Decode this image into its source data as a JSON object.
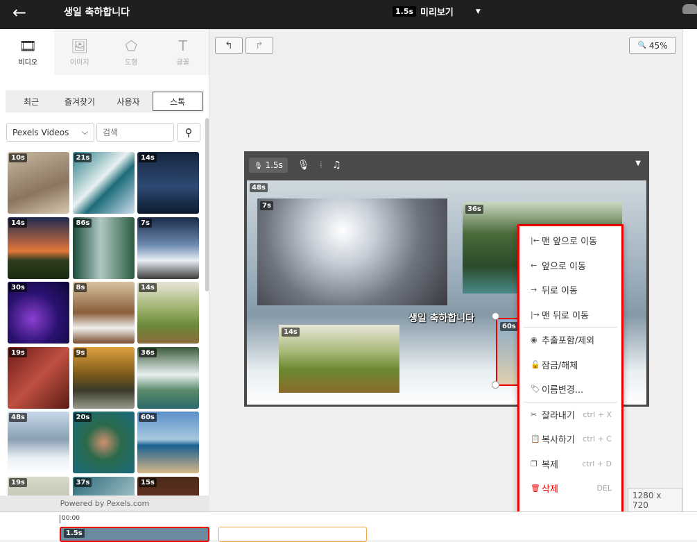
{
  "header": {
    "back_icon": "←",
    "title": "생일 축하합니다",
    "duration_tag": "1.5s",
    "preview_label": "미리보기",
    "caret": "▼"
  },
  "media_tabs": [
    {
      "label": "비디오",
      "icon": "film-icon",
      "glyph": "🎞",
      "active": true
    },
    {
      "label": "이미지",
      "icon": "image-icon",
      "glyph": "🖼",
      "active": false
    },
    {
      "label": "도형",
      "icon": "pentagon-icon",
      "glyph": "⬠",
      "active": false
    },
    {
      "label": "글꼴",
      "icon": "text-icon",
      "glyph": "T",
      "active": false
    }
  ],
  "sub_tabs": [
    {
      "label": "최근",
      "active": false
    },
    {
      "label": "즐겨찾기",
      "active": false
    },
    {
      "label": "사용자",
      "active": false
    },
    {
      "label": "스톡",
      "active": true
    }
  ],
  "search": {
    "source": "Pexels Videos",
    "placeholder": "검색"
  },
  "thumbnails": [
    {
      "dur": "10s",
      "bg": "linear-gradient(160deg,#c8b8a0,#8a7560 60%,#d9c9b0)"
    },
    {
      "dur": "21s",
      "bg": "linear-gradient(135deg,#2a7f8a,#e8f0f0 45%,#1d6c7a 60%,#cde)"
    },
    {
      "dur": "14s",
      "bg": "linear-gradient(180deg,#16243d,#2e4a74 55%,#0c1a2e)"
    },
    {
      "dur": "14s",
      "bg": "linear-gradient(180deg,#1d2a50,#e2763a 55%,#2e3d1e 70%,#1a2a10)"
    },
    {
      "dur": "86s",
      "bg": "linear-gradient(90deg,#1b4c3a,#b0c8c4 45%,#2a5c40)"
    },
    {
      "dur": "7s",
      "bg": "linear-gradient(180deg,#1b2b4a,#6d8bb0 45%,#e8eef4 70%,#3b3b3b)"
    },
    {
      "dur": "30s",
      "bg": "radial-gradient(circle at 40% 60%,#8b3fd0,#2a1170 50%,#0d0838)"
    },
    {
      "dur": "8s",
      "bg": "linear-gradient(180deg,#d9c2a0,#8a5e3a 50%,#f0f0f0 75%,#7a4a2a)"
    },
    {
      "dur": "14s",
      "bg": "linear-gradient(180deg,#e8e6d8,#9bb06a 45%,#6a8a3a 70%,#8a6a3a)"
    },
    {
      "dur": "19s",
      "bg": "linear-gradient(135deg,#6a1a1a,#c05040 50%,#5a1a14)"
    },
    {
      "dur": "9s",
      "bg": "linear-gradient(180deg,#e0a040,#7a5a1a 45%,#3a3a2a 70%,#9a9a8a)"
    },
    {
      "dur": "36s",
      "bg": "linear-gradient(180deg,#3a5a3a,#e8f0f0 45%,#5a8a6a 70%,#2a6a6a)"
    },
    {
      "dur": "48s",
      "bg": "linear-gradient(180deg,#c8d8e8,#8aa0b4 45%,#e8f0f4 75%,#fff)"
    },
    {
      "dur": "20s",
      "bg": "radial-gradient(circle at 50% 50%,#d09070,#2a6a4a 40%,#1a6a80)"
    },
    {
      "dur": "60s",
      "bg": "linear-gradient(180deg,#5a90c8,#a8c8e0 45%,#1a6090 55%,#d8b888)"
    },
    {
      "dur": "19s",
      "bg": "linear-gradient(180deg,#d8d8c8,#a8a898)"
    },
    {
      "dur": "37s",
      "bg": "linear-gradient(135deg,#2a6a7a,#d8e8e8)"
    },
    {
      "dur": "15s",
      "bg": "linear-gradient(180deg,#4a2a1a,#8a3a2a)"
    }
  ],
  "powered_by": "Powered by Pexels.com",
  "toolbar": {
    "undo_icon": "↰",
    "redo_icon": "↱",
    "zoom_icon": "🔍",
    "zoom": "45%"
  },
  "stage_bar": {
    "voice_duration": "1.5s",
    "mic_icon": "🎙",
    "waveform_icon": "⁞",
    "music_icon": "♫",
    "caret": "▼"
  },
  "layers": [
    {
      "dur": "48s"
    },
    {
      "dur": "7s"
    },
    {
      "dur": "36s"
    },
    {
      "dur": "14s"
    },
    {
      "dur": "60s"
    }
  ],
  "caption_text": "생일 축하합니다",
  "resolution": "1280 x 720",
  "context_menu": {
    "groups": [
      [
        {
          "icon": "|←",
          "name": "move-to-front",
          "label": "맨 앞으로 이동",
          "shortcut": ""
        },
        {
          "icon": "←",
          "name": "move-forward",
          "label": "앞으로 이동",
          "shortcut": ""
        },
        {
          "icon": "→",
          "name": "move-backward",
          "label": "뒤로 이동",
          "shortcut": ""
        },
        {
          "icon": "|→",
          "name": "move-to-back",
          "label": "맨 뒤로 이동",
          "shortcut": ""
        }
      ],
      [
        {
          "icon": "◉",
          "name": "toggle-export",
          "label": "추출포함/제외",
          "shortcut": ""
        },
        {
          "icon": "🔓",
          "name": "lock-toggle",
          "label": "잠금/해체",
          "shortcut": ""
        },
        {
          "icon": "🏷",
          "name": "rename",
          "label": "이름변경...",
          "shortcut": ""
        }
      ],
      [
        {
          "icon": "✂",
          "name": "cut",
          "label": "잘라내기",
          "shortcut": "ctrl + X"
        },
        {
          "icon": "📋",
          "name": "copy",
          "label": "복사하기",
          "shortcut": "ctrl + C"
        },
        {
          "icon": "❐",
          "name": "duplicate",
          "label": "복제",
          "shortcut": "ctrl + D"
        },
        {
          "icon": "🗑",
          "name": "delete",
          "label": "삭제",
          "shortcut": "DEL",
          "danger": true
        }
      ]
    ]
  },
  "timeline": {
    "time_marker": "00:00",
    "clip_duration": "1.5s"
  },
  "colors": {
    "accent_red": "#e00000",
    "dark_bar": "#1f1f1f",
    "timeline_orange": "#f2a640"
  }
}
